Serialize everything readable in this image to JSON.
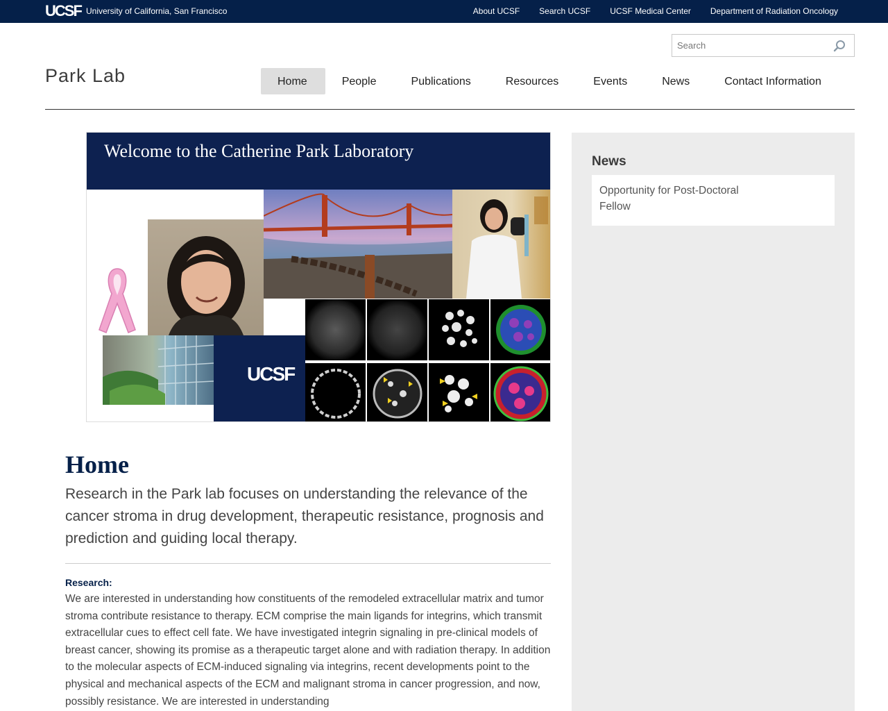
{
  "topbar": {
    "logo_text": "UCSF",
    "university": "University of California, San Francisco",
    "links": [
      "About UCSF",
      "Search UCSF",
      "UCSF Medical Center",
      "Department of Radiation Oncology"
    ]
  },
  "search": {
    "placeholder": "Search",
    "value": ""
  },
  "site_title": "Park Lab",
  "nav": {
    "items": [
      "Home",
      "People",
      "Publications",
      "Resources",
      "Events",
      "News",
      "Contact Information"
    ],
    "active": "Home"
  },
  "banner": {
    "title": "Welcome to the Catherine Park Laboratory",
    "logo_text": "UCSF"
  },
  "content": {
    "heading": "Home",
    "intro": "Research in the Park lab focuses on understanding the relevance of the cancer stroma in drug development, therapeutic resistance, prognosis and prediction and guiding local therapy.",
    "research_label": "Research:",
    "research_text": "We are interested in understanding how constituents of the remodeled extracellular matrix and tumor stroma contribute resistance to therapy. ECM comprise the main ligands for integrins, which transmit extracellular cues to effect cell fate. We have investigated integrin signaling in pre-clinical models of breast cancer, showing its promise as a therapeutic target alone and with radiation therapy. In addition to the molecular aspects of ECM-induced signaling via integrins, recent developments point to the physical and mechanical aspects of the ECM and malignant stroma in cancer progression, and now, possibly resistance. We are interested in understanding"
  },
  "sidebar": {
    "title": "News",
    "items": [
      "Opportunity for Post-Doctoral Fellow"
    ]
  },
  "colors": {
    "navy": "#052049",
    "banner_navy": "#0d2150",
    "sidebar_bg": "#ececec",
    "nav_active_bg": "#dedede"
  }
}
